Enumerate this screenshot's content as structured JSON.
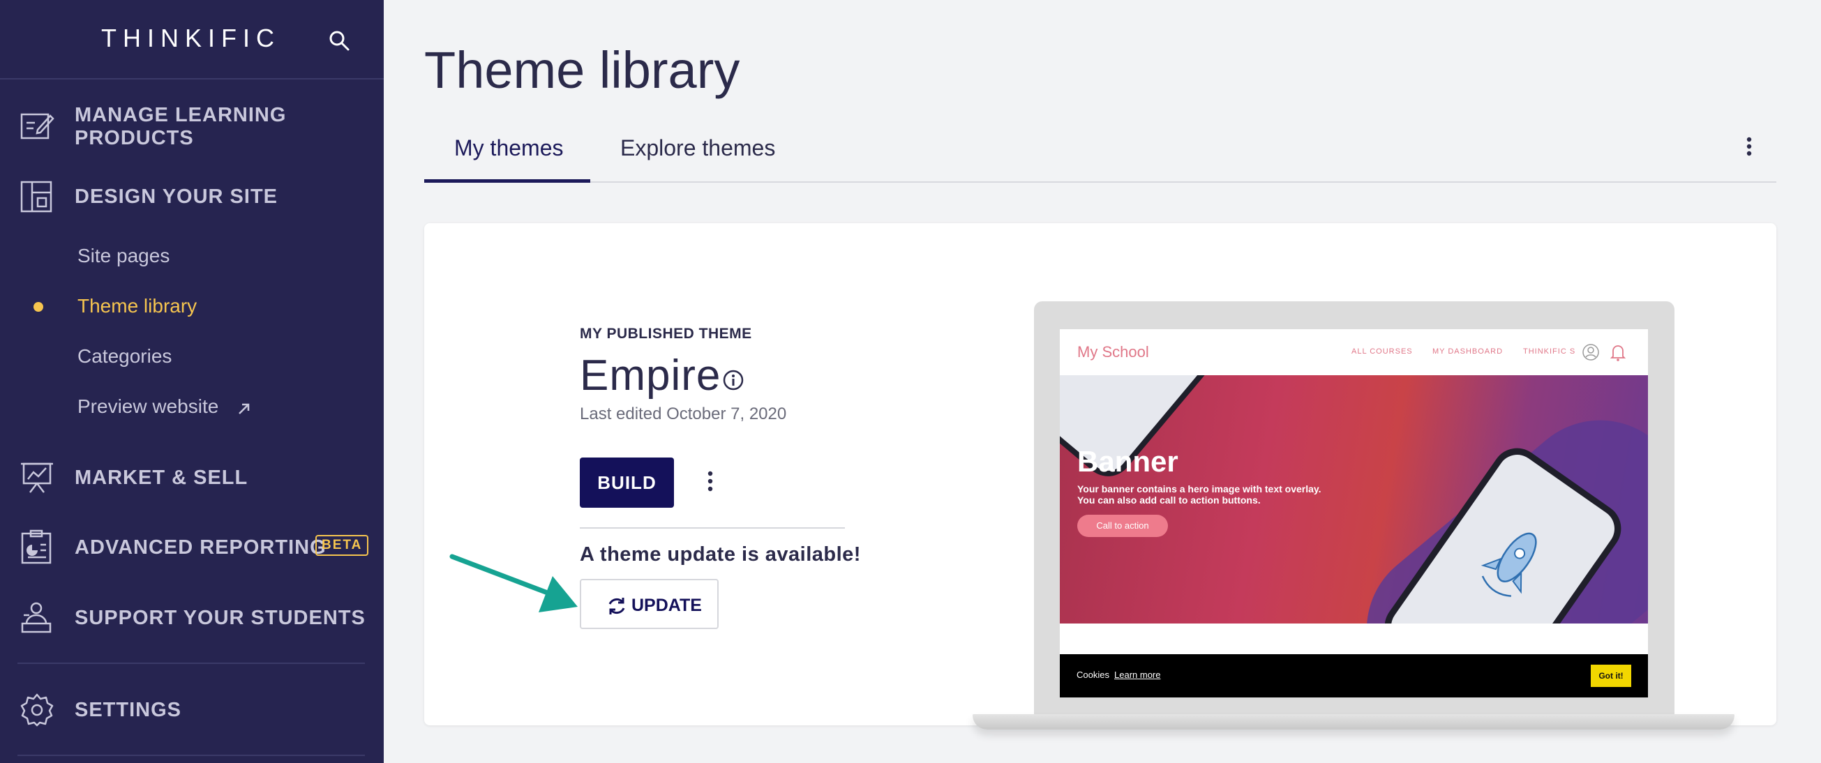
{
  "sidebar": {
    "brand": "THINKIFIC",
    "nav": [
      {
        "label": "MANAGE LEARNING PRODUCTS",
        "icon": "edit-board-icon"
      },
      {
        "label": "DESIGN YOUR SITE",
        "icon": "layout-icon"
      },
      {
        "label": "MARKET & SELL",
        "icon": "presentation-chart-icon"
      },
      {
        "label": "ADVANCED REPORTING",
        "icon": "report-clipboard-icon",
        "badge": "BETA"
      },
      {
        "label": "SUPPORT YOUR STUDENTS",
        "icon": "student-support-icon"
      },
      {
        "label": "SETTINGS",
        "icon": "gear-icon"
      }
    ],
    "sub_items": [
      {
        "label": "Site pages"
      },
      {
        "label": "Theme library",
        "active": true
      },
      {
        "label": "Categories"
      },
      {
        "label": "Preview website",
        "icon": "external-link-icon"
      }
    ],
    "accent_color": "#f6c54f"
  },
  "main": {
    "title": "Theme library",
    "tabs": [
      {
        "label": "My themes",
        "active": true
      },
      {
        "label": "Explore themes"
      }
    ]
  },
  "card": {
    "published_label": "MY PUBLISHED THEME",
    "theme_name": "Empire",
    "last_edited": "Last edited October 7, 2020",
    "build_label": "BUILD",
    "update_message": "A theme update is available!",
    "update_label": "UPDATE",
    "primary_color": "#14115a"
  },
  "preview": {
    "school_name": "My School",
    "nav_links": [
      "ALL COURSES",
      "MY DASHBOARD",
      "THINKIFIC S"
    ],
    "banner_title": "Banner",
    "banner_text_1": "Your banner contains a hero image with text overlay.",
    "banner_text_2": "You can also add call to action buttons.",
    "cta_label": "Call to action",
    "cookie_text": "Cookies",
    "cookie_link": "Learn more",
    "cookie_button": "Got it!"
  }
}
